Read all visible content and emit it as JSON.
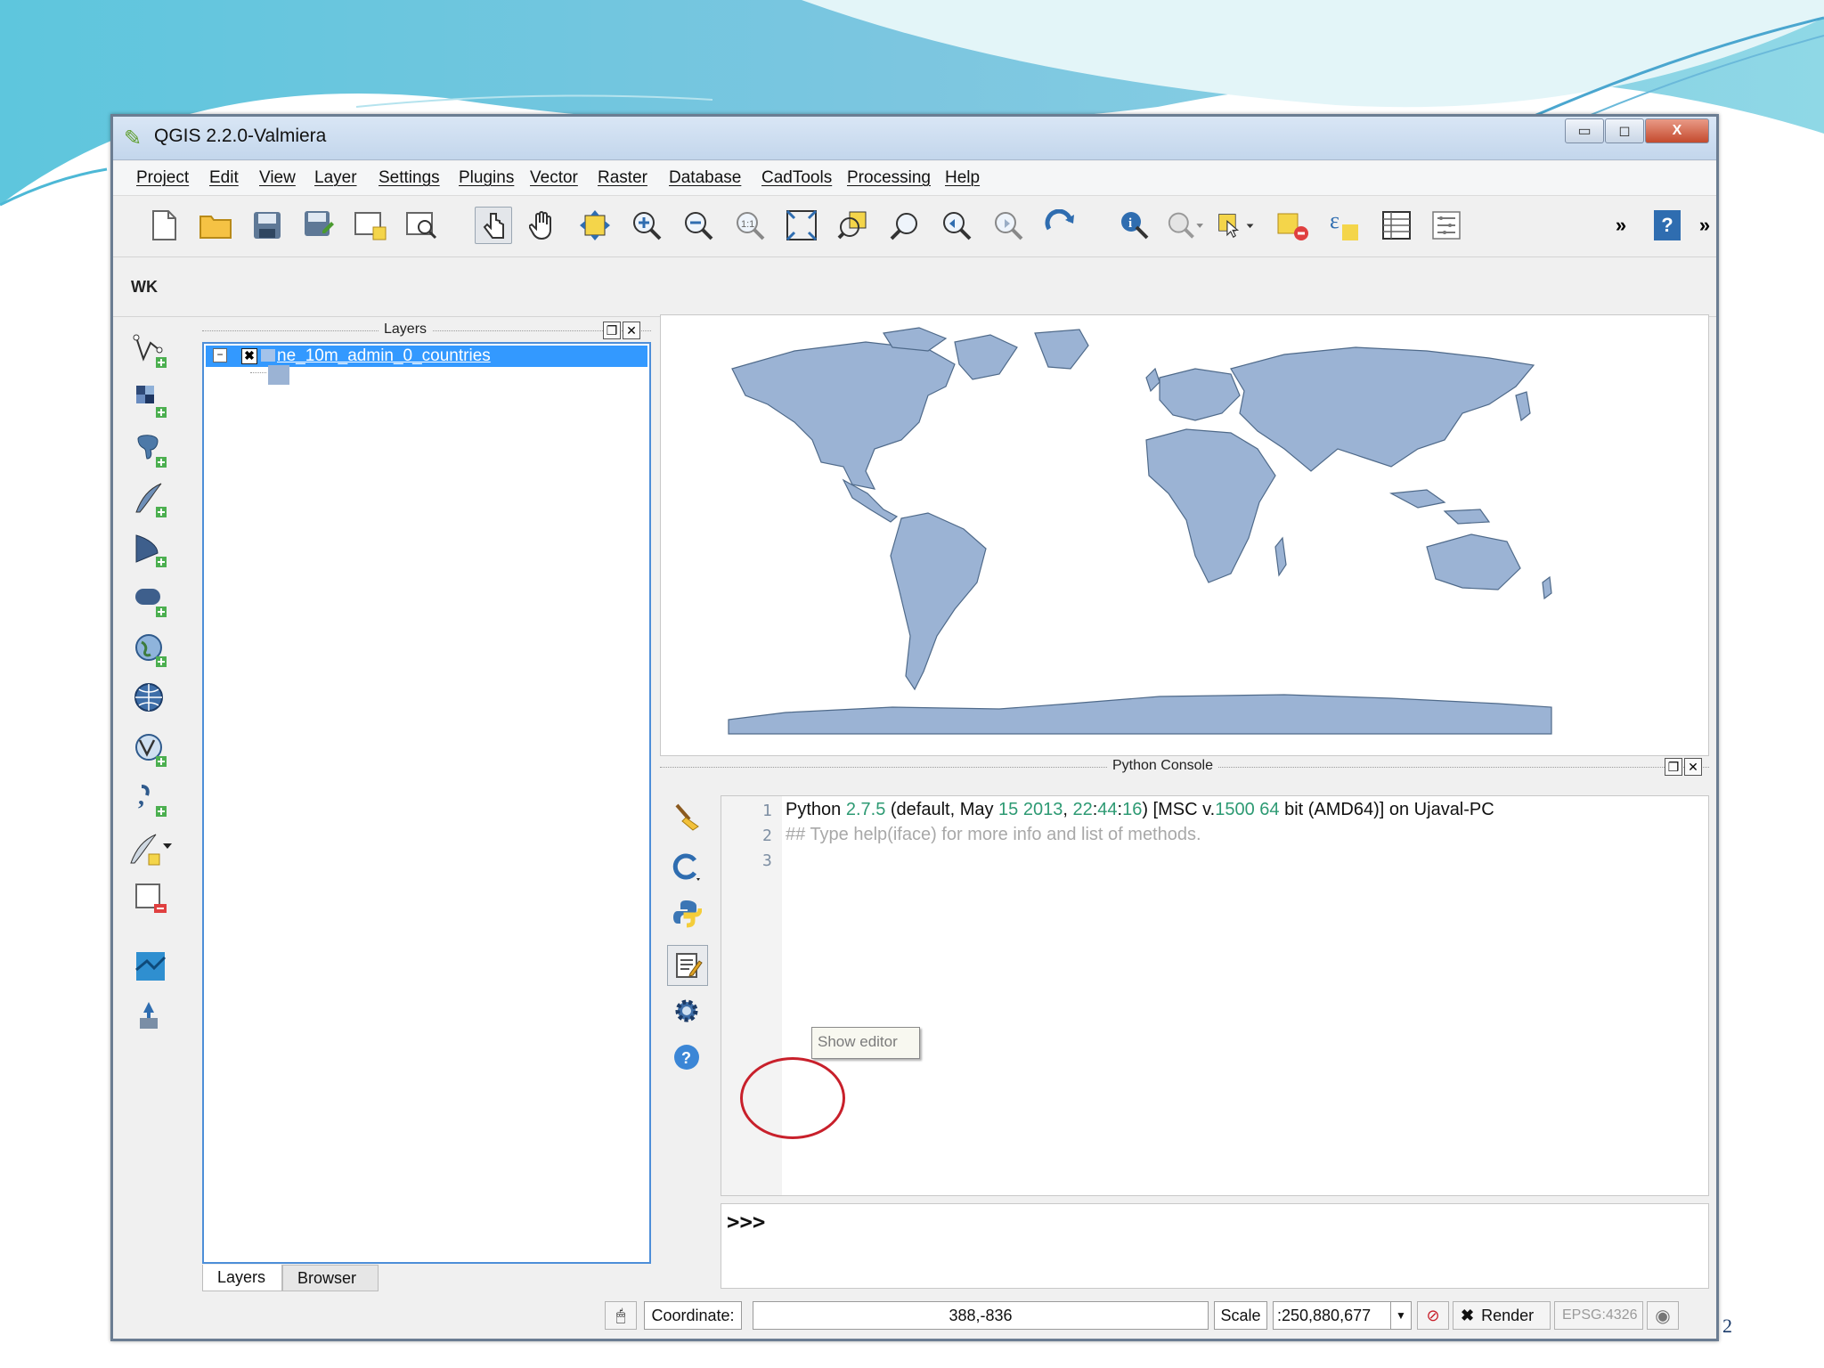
{
  "window": {
    "title": "QGIS 2.2.0-Valmiera",
    "minimize": "▭",
    "maximize": "◻",
    "close": "X"
  },
  "menu": [
    "Project",
    "Edit",
    "View",
    "Layer",
    "Settings",
    "Plugins",
    "Vector",
    "Raster",
    "Database",
    "CadTools",
    "Processing",
    "Help"
  ],
  "toolbar": {
    "overflow1": "»",
    "overflow2": "»",
    "help": "?",
    "plugin_label": "WK"
  },
  "layers_panel": {
    "title": "Layers",
    "layer_name": "ne_10m_admin_0_countries",
    "tabs": [
      "Layers",
      "Browser"
    ]
  },
  "console": {
    "title": "Python Console",
    "line_numbers": [
      "1",
      "2",
      "3"
    ],
    "line1": {
      "a": "Python ",
      "version": "2.7.5",
      "b": " (default, May ",
      "day": "15",
      "year": "2013",
      "hh": "22",
      "mm": "44",
      "ss": "16",
      "c": ") [MSC v.",
      "msc": "1500",
      "bits": "64",
      "d": " bit (AMD64)] on Ujaval-PC"
    },
    "line2": "## Type help(iface) for more info and list of methods.",
    "prompt": ">>>",
    "tooltip": "Show editor"
  },
  "statusbar": {
    "coordinate_label": "Coordinate:",
    "coordinate_value": "388,-836",
    "scale_label": "Scale",
    "scale_value": ":250,880,677",
    "render_label": "Render",
    "epsg": "EPSG:4326"
  },
  "page_number": "2",
  "colors": {
    "map_fill": "#9bb3d4",
    "selection": "#3399ff",
    "highlight": "#c8202b"
  }
}
